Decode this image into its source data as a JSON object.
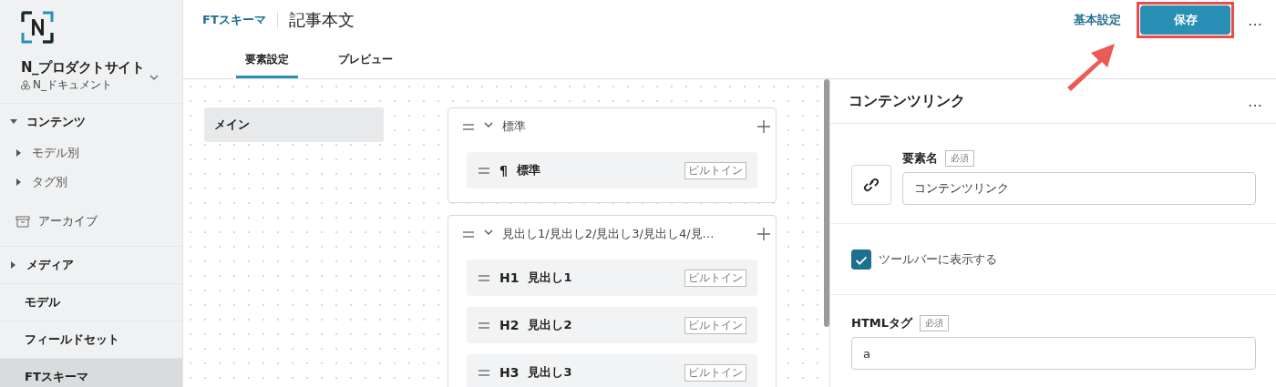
{
  "sidebar": {
    "site_name": "N_プロダクトサイト",
    "workspace": "N_ドキュメント",
    "items": [
      {
        "label": "コンテンツ",
        "kind": "group",
        "expanded": true,
        "selected": false,
        "children": [
          {
            "label": "モデル別",
            "kind": "subgroup",
            "expanded": false,
            "selected": false
          },
          {
            "label": "タグ別",
            "kind": "subgroup",
            "expanded": false,
            "selected": false
          }
        ]
      },
      {
        "label": "アーカイブ",
        "kind": "archive",
        "selected": false
      },
      {
        "label": "メディア",
        "kind": "group",
        "expanded": false,
        "selected": false
      },
      {
        "label": "モデル",
        "kind": "link",
        "selected": false
      },
      {
        "label": "フィールドセット",
        "kind": "link",
        "selected": false
      },
      {
        "label": "FTスキーマ",
        "kind": "link",
        "selected": true
      }
    ]
  },
  "header": {
    "breadcrumb": "FTスキーマ",
    "title": "記事本文",
    "settings_link": "基本設定",
    "save_button": "保存",
    "more": "…",
    "highlight_save": true
  },
  "tabs": [
    {
      "label": "要素設定",
      "selected": true
    },
    {
      "label": "プレビュー",
      "selected": false
    }
  ],
  "sections": [
    {
      "label": "メイン",
      "selected": true
    }
  ],
  "groups": [
    {
      "title": "標準",
      "expanded": true,
      "items": [
        {
          "mark": "¶",
          "label": "標準",
          "badge": "ビルトイン"
        }
      ]
    },
    {
      "title": "見出し1/見出し2/見出し3/見出し4/見…",
      "expanded": true,
      "items": [
        {
          "mark": "H1",
          "label": "見出し1",
          "badge": "ビルトイン"
        },
        {
          "mark": "H2",
          "label": "見出し2",
          "badge": "ビルトイン"
        },
        {
          "mark": "H3",
          "label": "見出し3",
          "badge": "ビルトイン"
        }
      ]
    }
  ],
  "panel": {
    "title": "コンテンツリンク",
    "name_label": "要素名",
    "name_required": "必須",
    "name_value": "コンテンツリンク",
    "toolbar_checkbox": {
      "label": "ツールバーに表示する",
      "checked": true
    },
    "tag_label": "HTMLタグ",
    "tag_required": "必須",
    "tag_value": "a"
  }
}
